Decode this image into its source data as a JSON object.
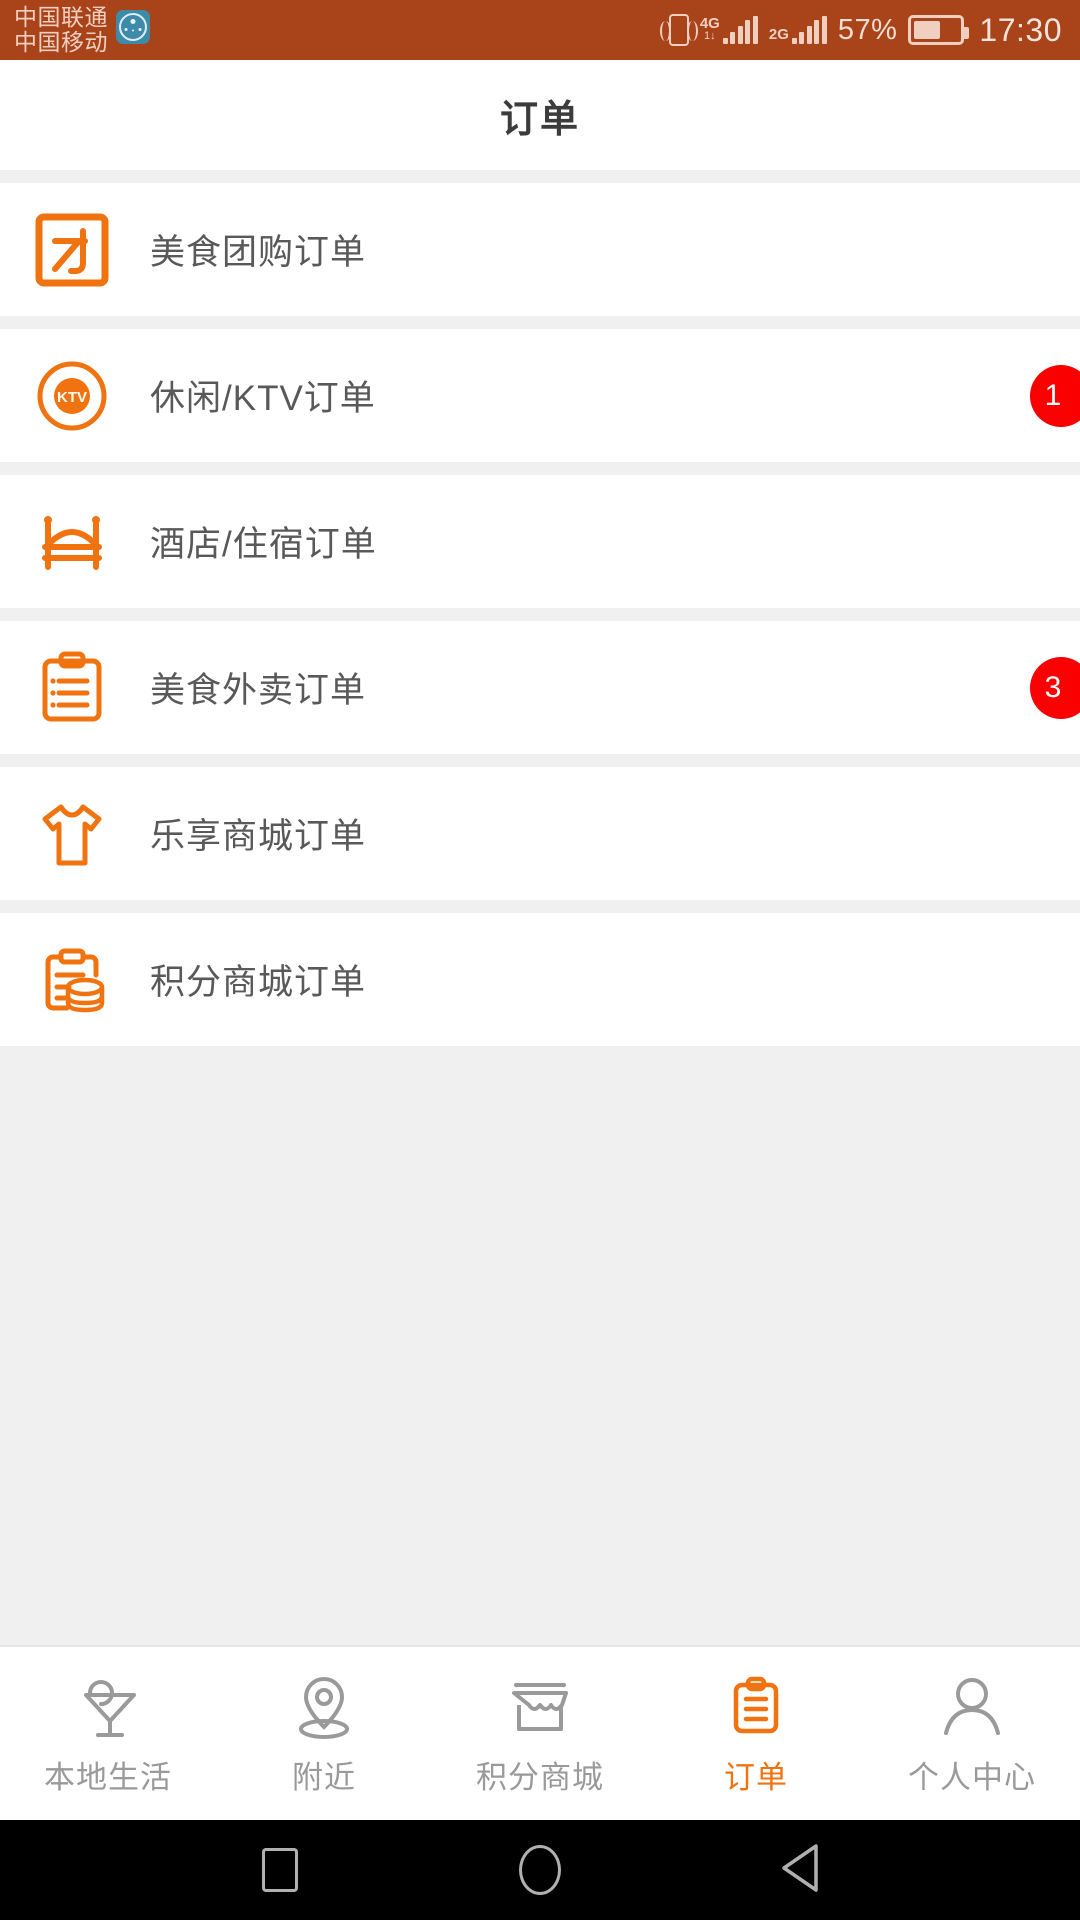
{
  "statusbar": {
    "carrier_primary": "中国联通",
    "carrier_secondary": "中国移动",
    "gov_badge_icon": "government-app-badge-icon",
    "vibrate_icon": "vibrate-icon",
    "network_1": "4G",
    "network_1_sub": "1↓",
    "network_2": "2G",
    "battery_percent": "57%",
    "battery_level": 57,
    "time": "17:30",
    "bg_color": "#a8431a",
    "fg_color": "#f0cfc0"
  },
  "header": {
    "title": "订单"
  },
  "theme": {
    "accent": "#f07310",
    "badge_red": "#fa0000",
    "text_primary": "#595959",
    "text_muted": "#9a9a9a",
    "divider": "#f0f0f0"
  },
  "orders": {
    "items": [
      {
        "label": "美食团购订单",
        "icon": "group-buy-icon",
        "badge": null
      },
      {
        "label": "休闲/KTV订单",
        "icon": "ktv-icon",
        "badge": "1"
      },
      {
        "label": "酒店/住宿订单",
        "icon": "hotel-bed-icon",
        "badge": null
      },
      {
        "label": "美食外卖订单",
        "icon": "takeout-clipboard-icon",
        "badge": "3"
      },
      {
        "label": "乐享商城订单",
        "icon": "tshirt-icon",
        "badge": null
      },
      {
        "label": "积分商城订单",
        "icon": "points-coins-icon",
        "badge": null
      }
    ]
  },
  "bottomnav": {
    "items": [
      {
        "label": "本地生活",
        "icon": "cocktail-icon",
        "active": false
      },
      {
        "label": "附近",
        "icon": "location-pin-icon",
        "active": false
      },
      {
        "label": "积分商城",
        "icon": "storefront-icon",
        "active": false
      },
      {
        "label": "订单",
        "icon": "clipboard-icon",
        "active": true
      },
      {
        "label": "个人中心",
        "icon": "person-icon",
        "active": false
      }
    ]
  },
  "androidnav": {
    "recents_icon": "square-recents-icon",
    "home_icon": "circle-home-icon",
    "back_icon": "triangle-back-icon"
  }
}
